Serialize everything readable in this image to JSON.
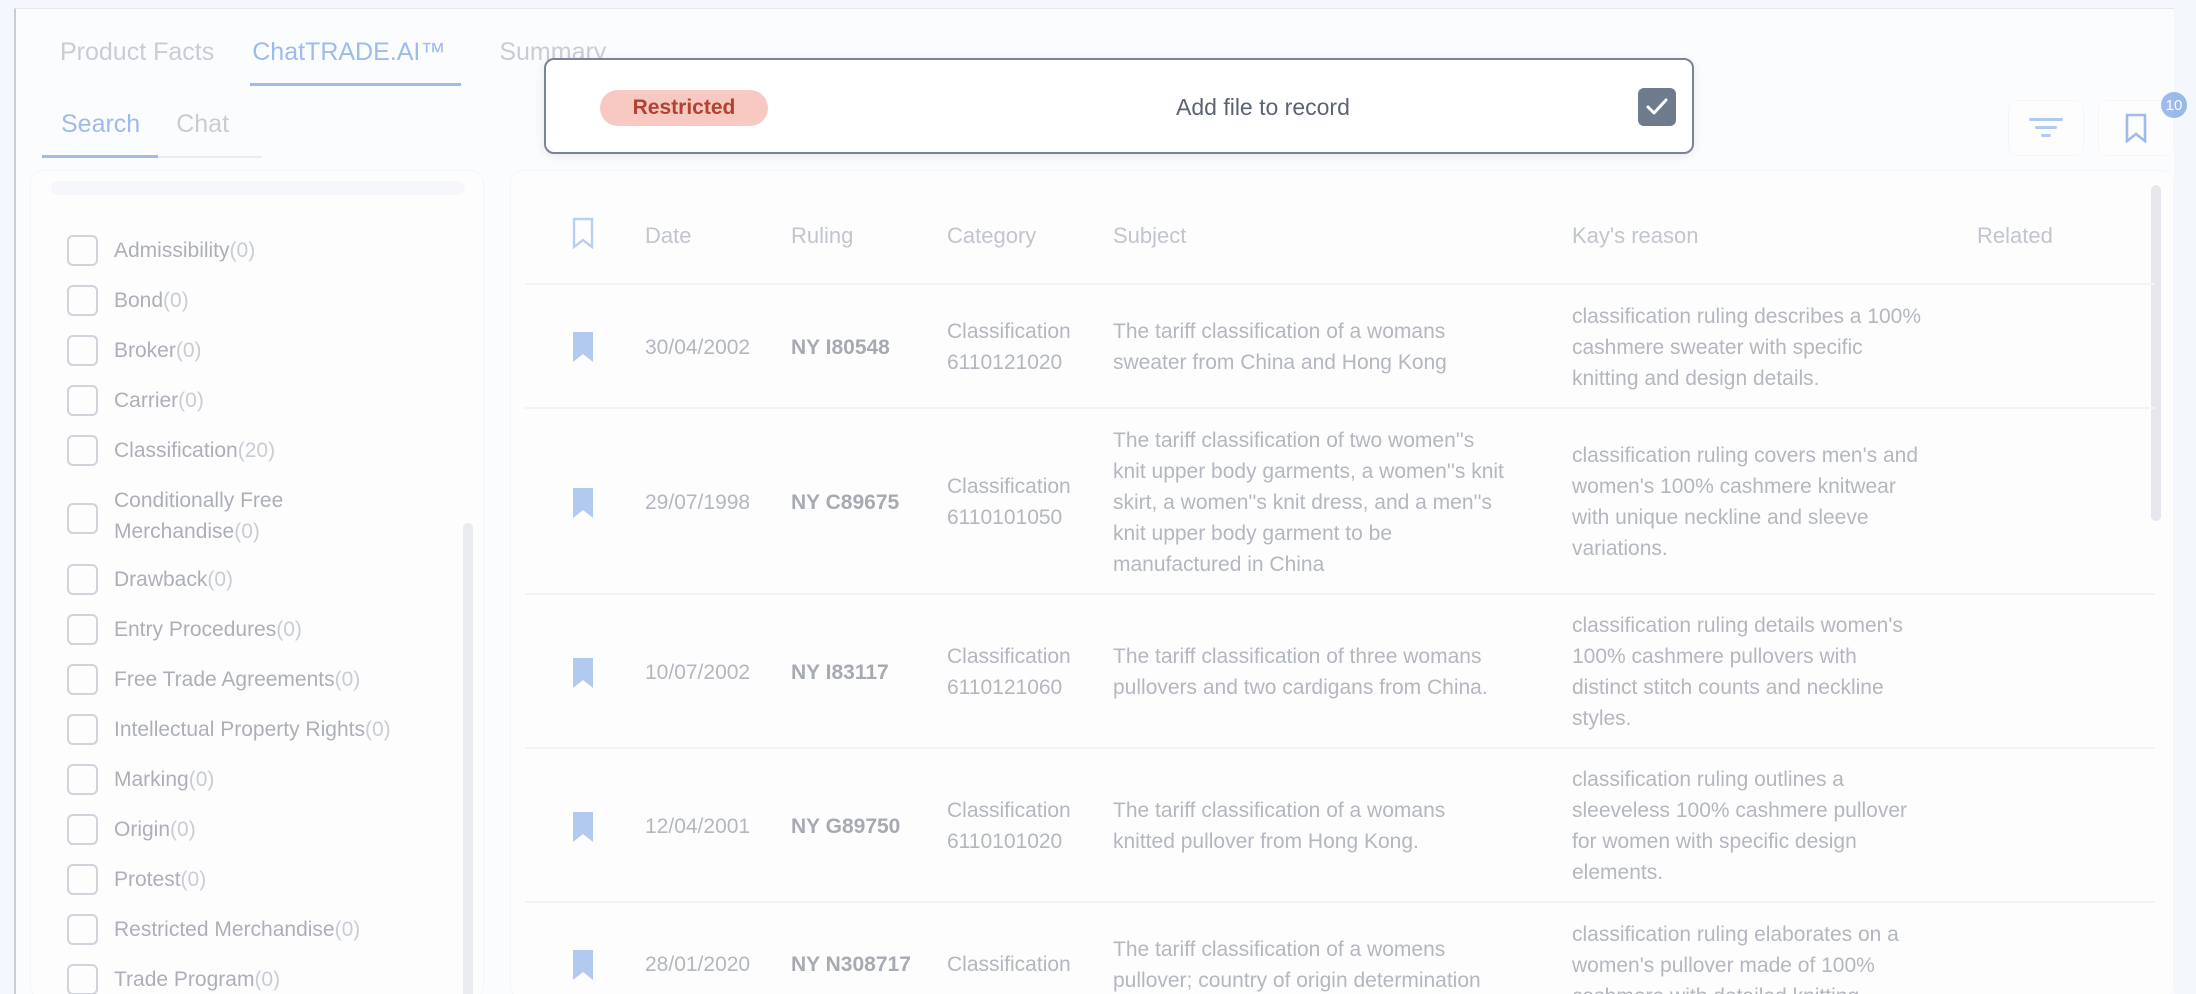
{
  "top_tabs": [
    {
      "label": "Product Facts"
    },
    {
      "label": "ChatTRADE.AI™"
    },
    {
      "label": "Summary"
    }
  ],
  "sub_tabs": [
    {
      "label": "Search"
    },
    {
      "label": "Chat"
    }
  ],
  "filters": [
    {
      "label": "Admissibility",
      "count": "(0)"
    },
    {
      "label": "Bond",
      "count": "(0)"
    },
    {
      "label": "Broker",
      "count": "(0)"
    },
    {
      "label": "Carrier",
      "count": "(0)"
    },
    {
      "label": "Classification",
      "count": "(20)"
    },
    {
      "label": "Conditionally Free Merchandise",
      "count": "(0)"
    },
    {
      "label": "Drawback",
      "count": "(0)"
    },
    {
      "label": "Entry Procedures",
      "count": "(0)"
    },
    {
      "label": "Free Trade Agreements",
      "count": "(0)"
    },
    {
      "label": "Intellectual Property Rights",
      "count": "(0)"
    },
    {
      "label": "Marking",
      "count": "(0)"
    },
    {
      "label": "Origin",
      "count": "(0)"
    },
    {
      "label": "Protest",
      "count": "(0)"
    },
    {
      "label": "Restricted Merchandise",
      "count": "(0)"
    },
    {
      "label": "Trade Program",
      "count": "(0)"
    }
  ],
  "toolbar": {
    "badge": "10",
    "filter_icon": "filter-icon",
    "bookmark_icon": "bookmark-icon"
  },
  "table": {
    "headers": {
      "date": "Date",
      "ruling": "Ruling",
      "category": "Category",
      "subject": "Subject",
      "reason": "Kay's reason",
      "related": "Related"
    },
    "rows": [
      {
        "date": "30/04/2002",
        "ruling": "NY I80548",
        "cat1": "Classification",
        "cat2": "6110121020",
        "subject": [
          "The tariff classification of a womans",
          "sweater from China and Hong Kong"
        ],
        "reason": [
          "classification ruling describes a 100%",
          "cashmere sweater with specific",
          "knitting and design details."
        ]
      },
      {
        "date": "29/07/1998",
        "ruling": "NY C89675",
        "cat1": "Classification",
        "cat2": "6110101050",
        "subject": [
          "The tariff classification of two women''s",
          "knit upper body garments, a women''s knit",
          "skirt, a women''s knit dress, and a men''s",
          "knit upper body garment to be",
          "manufactured in China"
        ],
        "reason": [
          "classification ruling covers men's and",
          "women's 100% cashmere knitwear",
          "with unique neckline and sleeve",
          "variations."
        ]
      },
      {
        "date": "10/07/2002",
        "ruling": "NY I83117",
        "cat1": "Classification",
        "cat2": "6110121060",
        "subject": [
          "The tariff classification of three womans",
          "pullovers and two cardigans from China."
        ],
        "reason": [
          "classification ruling details women's",
          "100% cashmere pullovers with",
          "distinct stitch counts and neckline",
          "styles."
        ]
      },
      {
        "date": "12/04/2001",
        "ruling": "NY G89750",
        "cat1": "Classification",
        "cat2": "6110101020",
        "subject": [
          "The tariff classification of a womans",
          "knitted pullover from Hong Kong."
        ],
        "reason": [
          "classification ruling outlines a",
          "sleeveless 100% cashmere pullover",
          "for women with specific design",
          "elements."
        ]
      },
      {
        "date": "28/01/2020",
        "ruling": "NY N308717",
        "cat1": "Classification",
        "cat2": "",
        "subject": [
          "The tariff classification of a womens",
          "pullover; country of origin determination"
        ],
        "reason": [
          "classification ruling elaborates on a",
          "women's pullover made of 100%",
          "cashmere with detailed knitting"
        ]
      }
    ]
  },
  "modal": {
    "badge": "Restricted",
    "text": "Add file to record",
    "checked": true
  }
}
